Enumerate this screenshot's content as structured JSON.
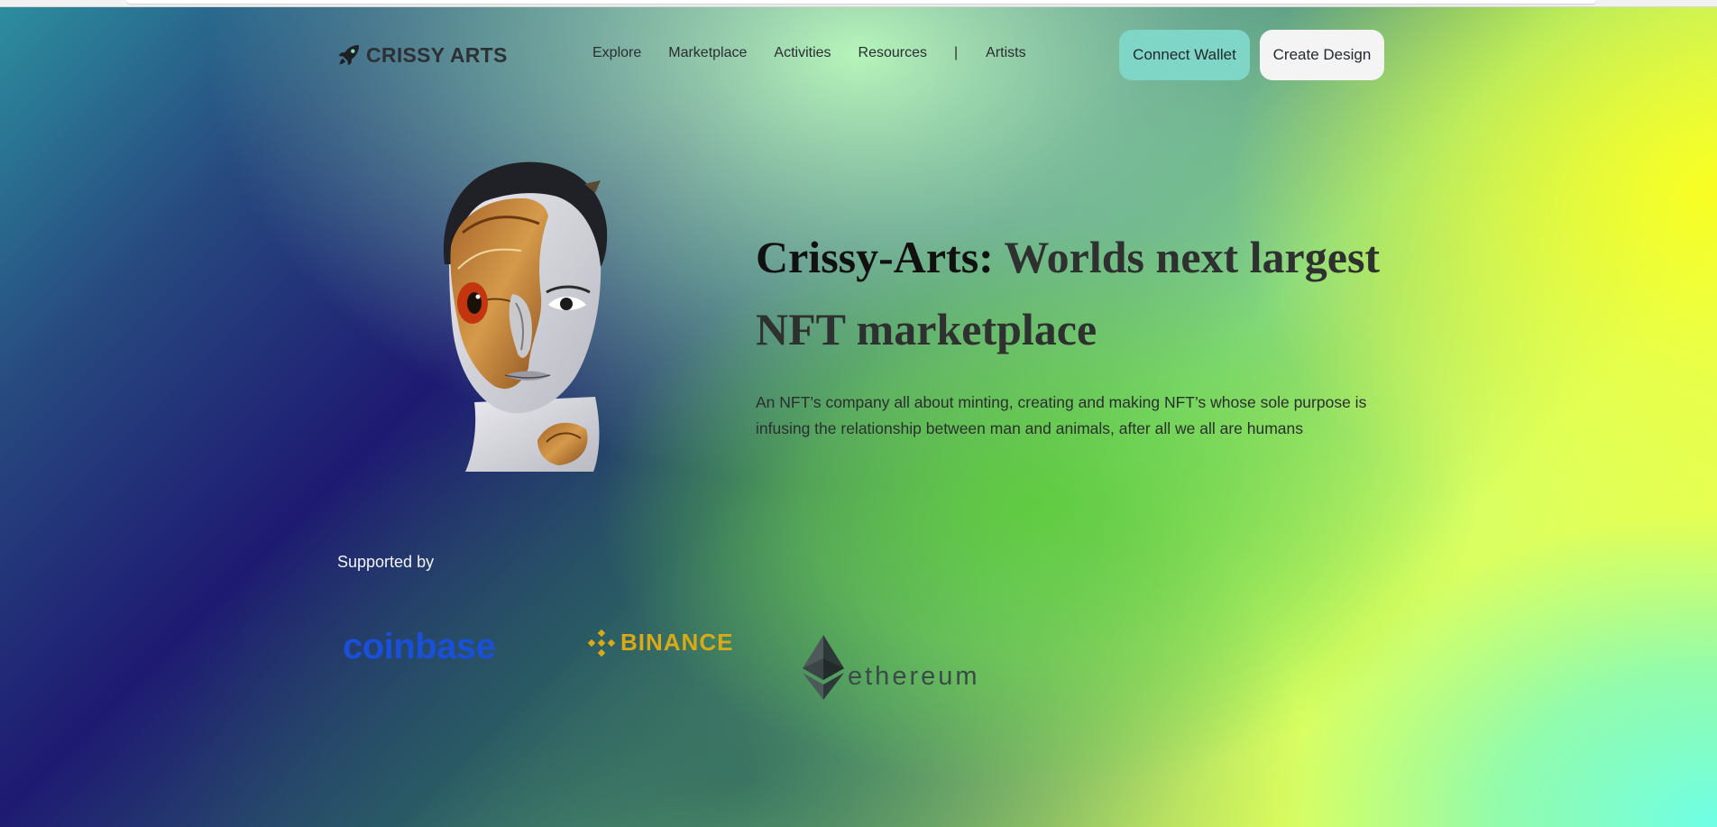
{
  "brand": {
    "name": "CRISSY ARTS",
    "logo_icon": "rocket-icon"
  },
  "nav": {
    "items": [
      {
        "label": "Explore"
      },
      {
        "label": "Marketplace"
      },
      {
        "label": "Activities"
      },
      {
        "label": "Resources"
      },
      {
        "label": "|"
      },
      {
        "label": "Artists"
      }
    ]
  },
  "actions": {
    "connect_wallet": "Connect Wallet",
    "create_design": "Create Design"
  },
  "hero": {
    "title_brand": "Crissy-Arts:",
    "title_rest": " Worlds next largest NFT marketplace",
    "description": "An NFT’s company all about minting, creating and making NFT’s whose sole purpose is infusing the relationship between man and animals, after all we all are humans",
    "image": "eagle-human-face-artwork"
  },
  "supported": {
    "label": "Supported by",
    "partners": [
      {
        "name": "coinbase"
      },
      {
        "name": "BINANCE"
      },
      {
        "name": "ethereum"
      }
    ]
  },
  "colors": {
    "connect_wallet_bg": "#7fd6c6",
    "create_design_bg": "#f4f4f5",
    "coinbase_blue": "#1a4fd8",
    "binance_gold": "#d9aa18"
  }
}
